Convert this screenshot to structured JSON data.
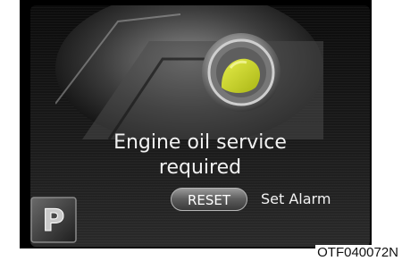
{
  "display": {
    "message_line1": "Engine oil service",
    "message_line2": "required",
    "reset_label": "RESET",
    "set_alarm_label": "Set Alarm",
    "p_icon_letter": "P"
  },
  "illustration": {
    "subject": "engine-oil-cap-icon",
    "highlight_color": "#c8d424"
  },
  "caption": "OTF040072N",
  "colors": {
    "background": "#000000",
    "text": "#f2f2f2"
  }
}
